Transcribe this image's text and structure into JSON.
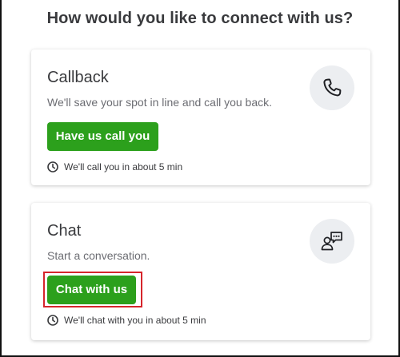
{
  "heading": "How would you like to connect with us?",
  "callback": {
    "title": "Callback",
    "description": "We'll save your spot in line and call you back.",
    "button_label": "Have us call you",
    "wait_text": "We'll call you in about 5 min",
    "icon": "phone-icon"
  },
  "chat": {
    "title": "Chat",
    "description": "Start a conversation.",
    "button_label": "Chat with us",
    "wait_text": "We'll chat with you in about 5 min",
    "icon": "chat-agent-icon"
  },
  "colors": {
    "primary_button": "#2ca01c",
    "highlight": "#d6252b",
    "text": "#393a3d",
    "icon_bg": "#eceef1"
  }
}
